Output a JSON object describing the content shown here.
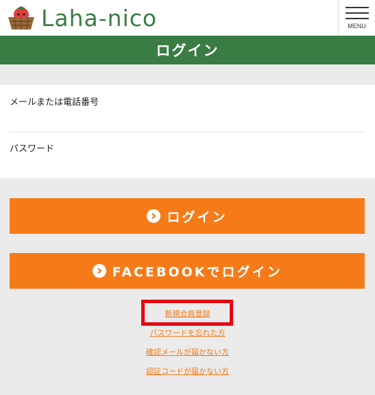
{
  "header": {
    "logo_text": "Laha-nico",
    "menu_label": "MENU"
  },
  "page": {
    "title": "ログイン"
  },
  "form": {
    "email_label": "メールまたは電話番号",
    "email_value": "",
    "password_label": "パスワード",
    "password_value": ""
  },
  "buttons": {
    "login_label": "ログイン",
    "facebook_label": "FACEBOOKでログイン"
  },
  "links": {
    "register": "新規会員登録",
    "forgot_password": "パスワードを忘れた方",
    "no_confirm_mail": "確認メールが届かない方",
    "no_auth_code": "認証コードが届かない方"
  },
  "colors": {
    "brand_green": "#3a7d44",
    "accent_orange": "#f57b19",
    "highlight_red": "#e60012"
  }
}
